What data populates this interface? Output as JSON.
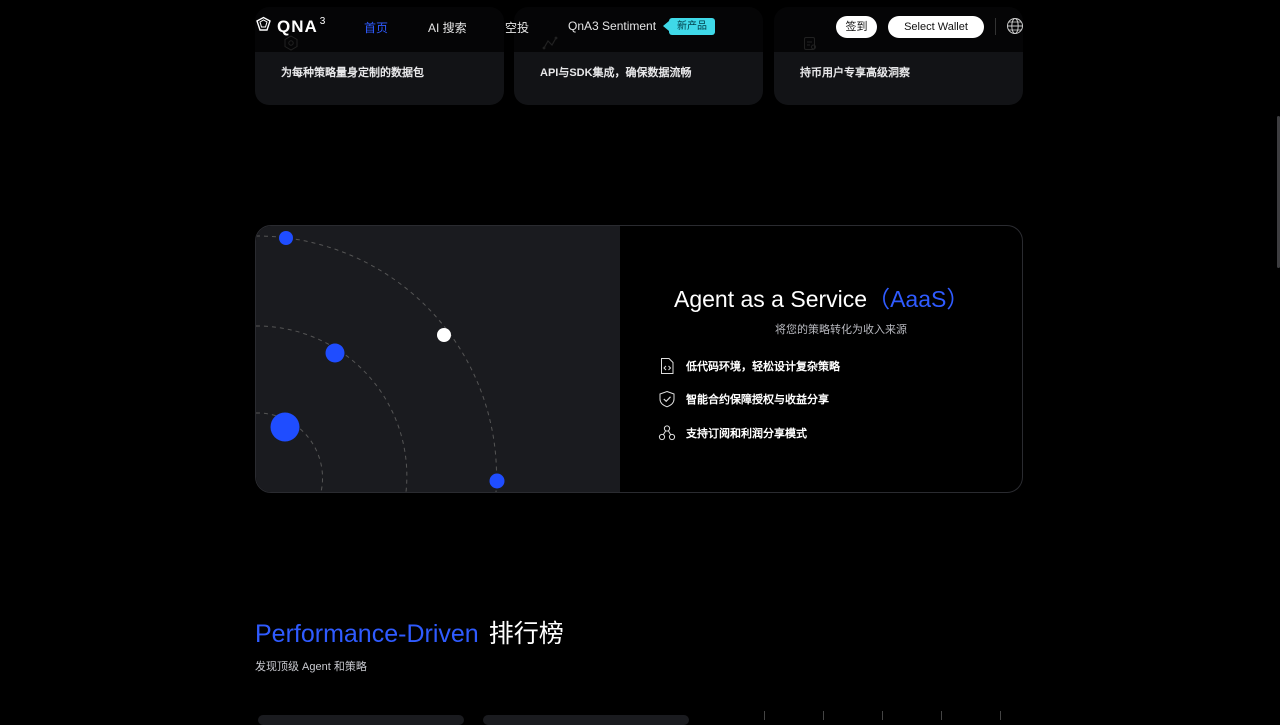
{
  "colors": {
    "accent": "#2f5bff",
    "badge": "#3fd9e8",
    "panel": "#1a1b1f",
    "card": "#121316"
  },
  "features": [
    {
      "icon": "data-package-icon",
      "text": "为每种策略量身定制的数据包"
    },
    {
      "icon": "api-integration-icon",
      "text": "API与SDK集成，确保数据流畅"
    },
    {
      "icon": "clipboard-insight-icon",
      "text": "持币用户专享高级洞察"
    }
  ],
  "header": {
    "logo_text": "QNA",
    "logo_sup": "3",
    "nav": [
      {
        "label": "首页",
        "active": true
      },
      {
        "label": "AI 搜索"
      },
      {
        "label": "空投"
      },
      {
        "label": "QnA3 Sentiment"
      }
    ],
    "new_badge": "新产品",
    "checkin_label": "签到",
    "wallet_label": "Select Wallet",
    "language_icon": "globe-icon"
  },
  "aaas": {
    "title_main": "Agent as a Service",
    "title_accent": "（AaaS）",
    "subtitle": "将您的策略转化为收入来源",
    "features": [
      {
        "icon": "code-file-icon",
        "label": "低代码环境，轻松设计复杂策略"
      },
      {
        "icon": "shield-check-icon",
        "label": "智能合约保障授权与收益分享"
      },
      {
        "icon": "share-nodes-icon",
        "label": "支持订阅和利润分享模式"
      }
    ]
  },
  "leaderboard": {
    "title_en": "Performance-Driven",
    "title_zh": "排行榜",
    "subtitle": "发现顶级 Agent 和策略"
  }
}
